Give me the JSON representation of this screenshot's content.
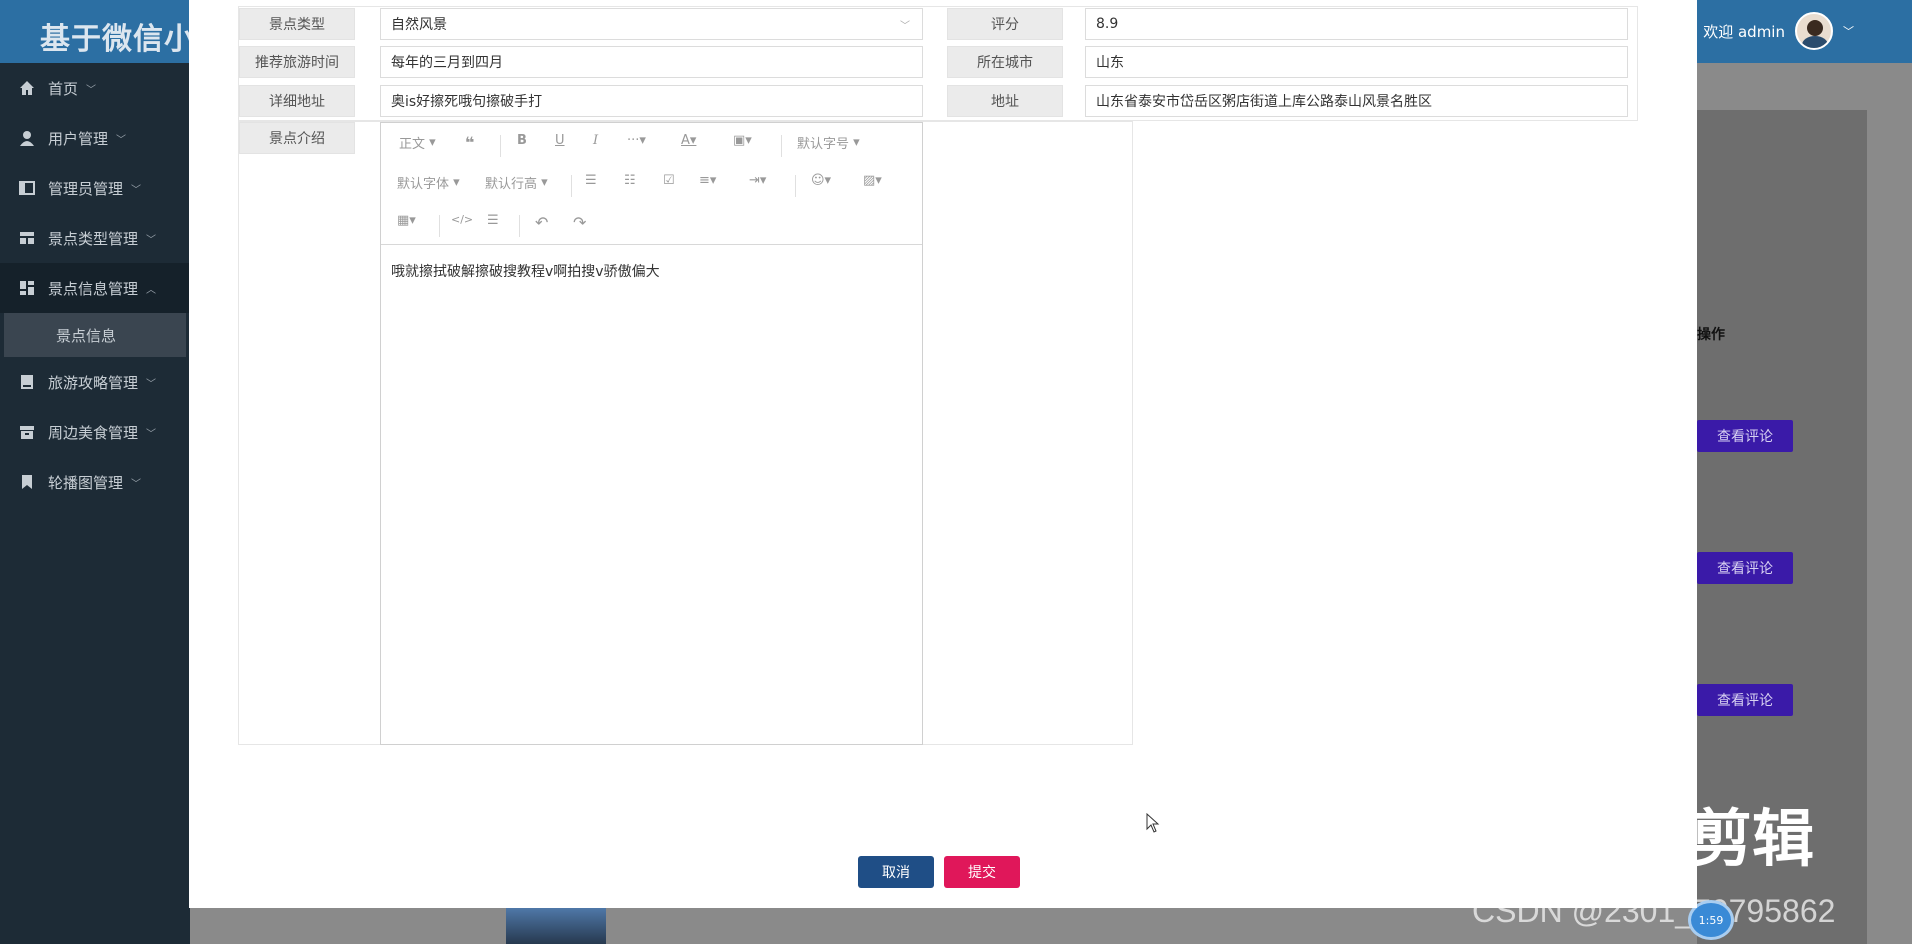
{
  "app": {
    "title": "基于微信小",
    "welcome": "欢迎 admin"
  },
  "sidebar": {
    "items": [
      {
        "label": "首页",
        "icon": "home-icon"
      },
      {
        "label": "用户管理",
        "icon": "user-icon"
      },
      {
        "label": "管理员管理",
        "icon": "admin-icon"
      },
      {
        "label": "景点类型管理",
        "icon": "grid-icon"
      },
      {
        "label": "景点信息管理",
        "icon": "dashboard-icon",
        "open": true
      },
      {
        "label": "旅游攻略管理",
        "icon": "book-icon"
      },
      {
        "label": "周边美食管理",
        "icon": "box-icon"
      },
      {
        "label": "轮播图管理",
        "icon": "bookmark-icon"
      }
    ],
    "sub_item": "景点信息"
  },
  "background": {
    "op_header": "操作",
    "view_comment_label": "查看评论",
    "watermark_edit": "剪辑",
    "csdn": "CSDN @2301_79795862",
    "clock": "1:59"
  },
  "form": {
    "type_label": "景点类型",
    "type_value": "自然风景",
    "rating_label": "评分",
    "rating_value": "8.9",
    "time_label": "推荐旅游时间",
    "time_value": "每年的三月到四月",
    "city_label": "所在城市",
    "city_value": "山东",
    "detail_addr_label": "详细地址",
    "detail_addr_value": "奥is好擦死哦句擦破手打",
    "addr_label": "地址",
    "addr_value": "山东省泰安市岱岳区粥店街道上库公路泰山风景名胜区",
    "intro_label": "景点介绍"
  },
  "editor": {
    "heading_select": "正文",
    "font_size": "默认字号",
    "font_family": "默认字体",
    "line_height": "默认行高",
    "content": "哦就擦拭破解擦破搜教程v啊拍搜v骄傲偏大"
  },
  "buttons": {
    "cancel": "取消",
    "submit": "提交"
  }
}
